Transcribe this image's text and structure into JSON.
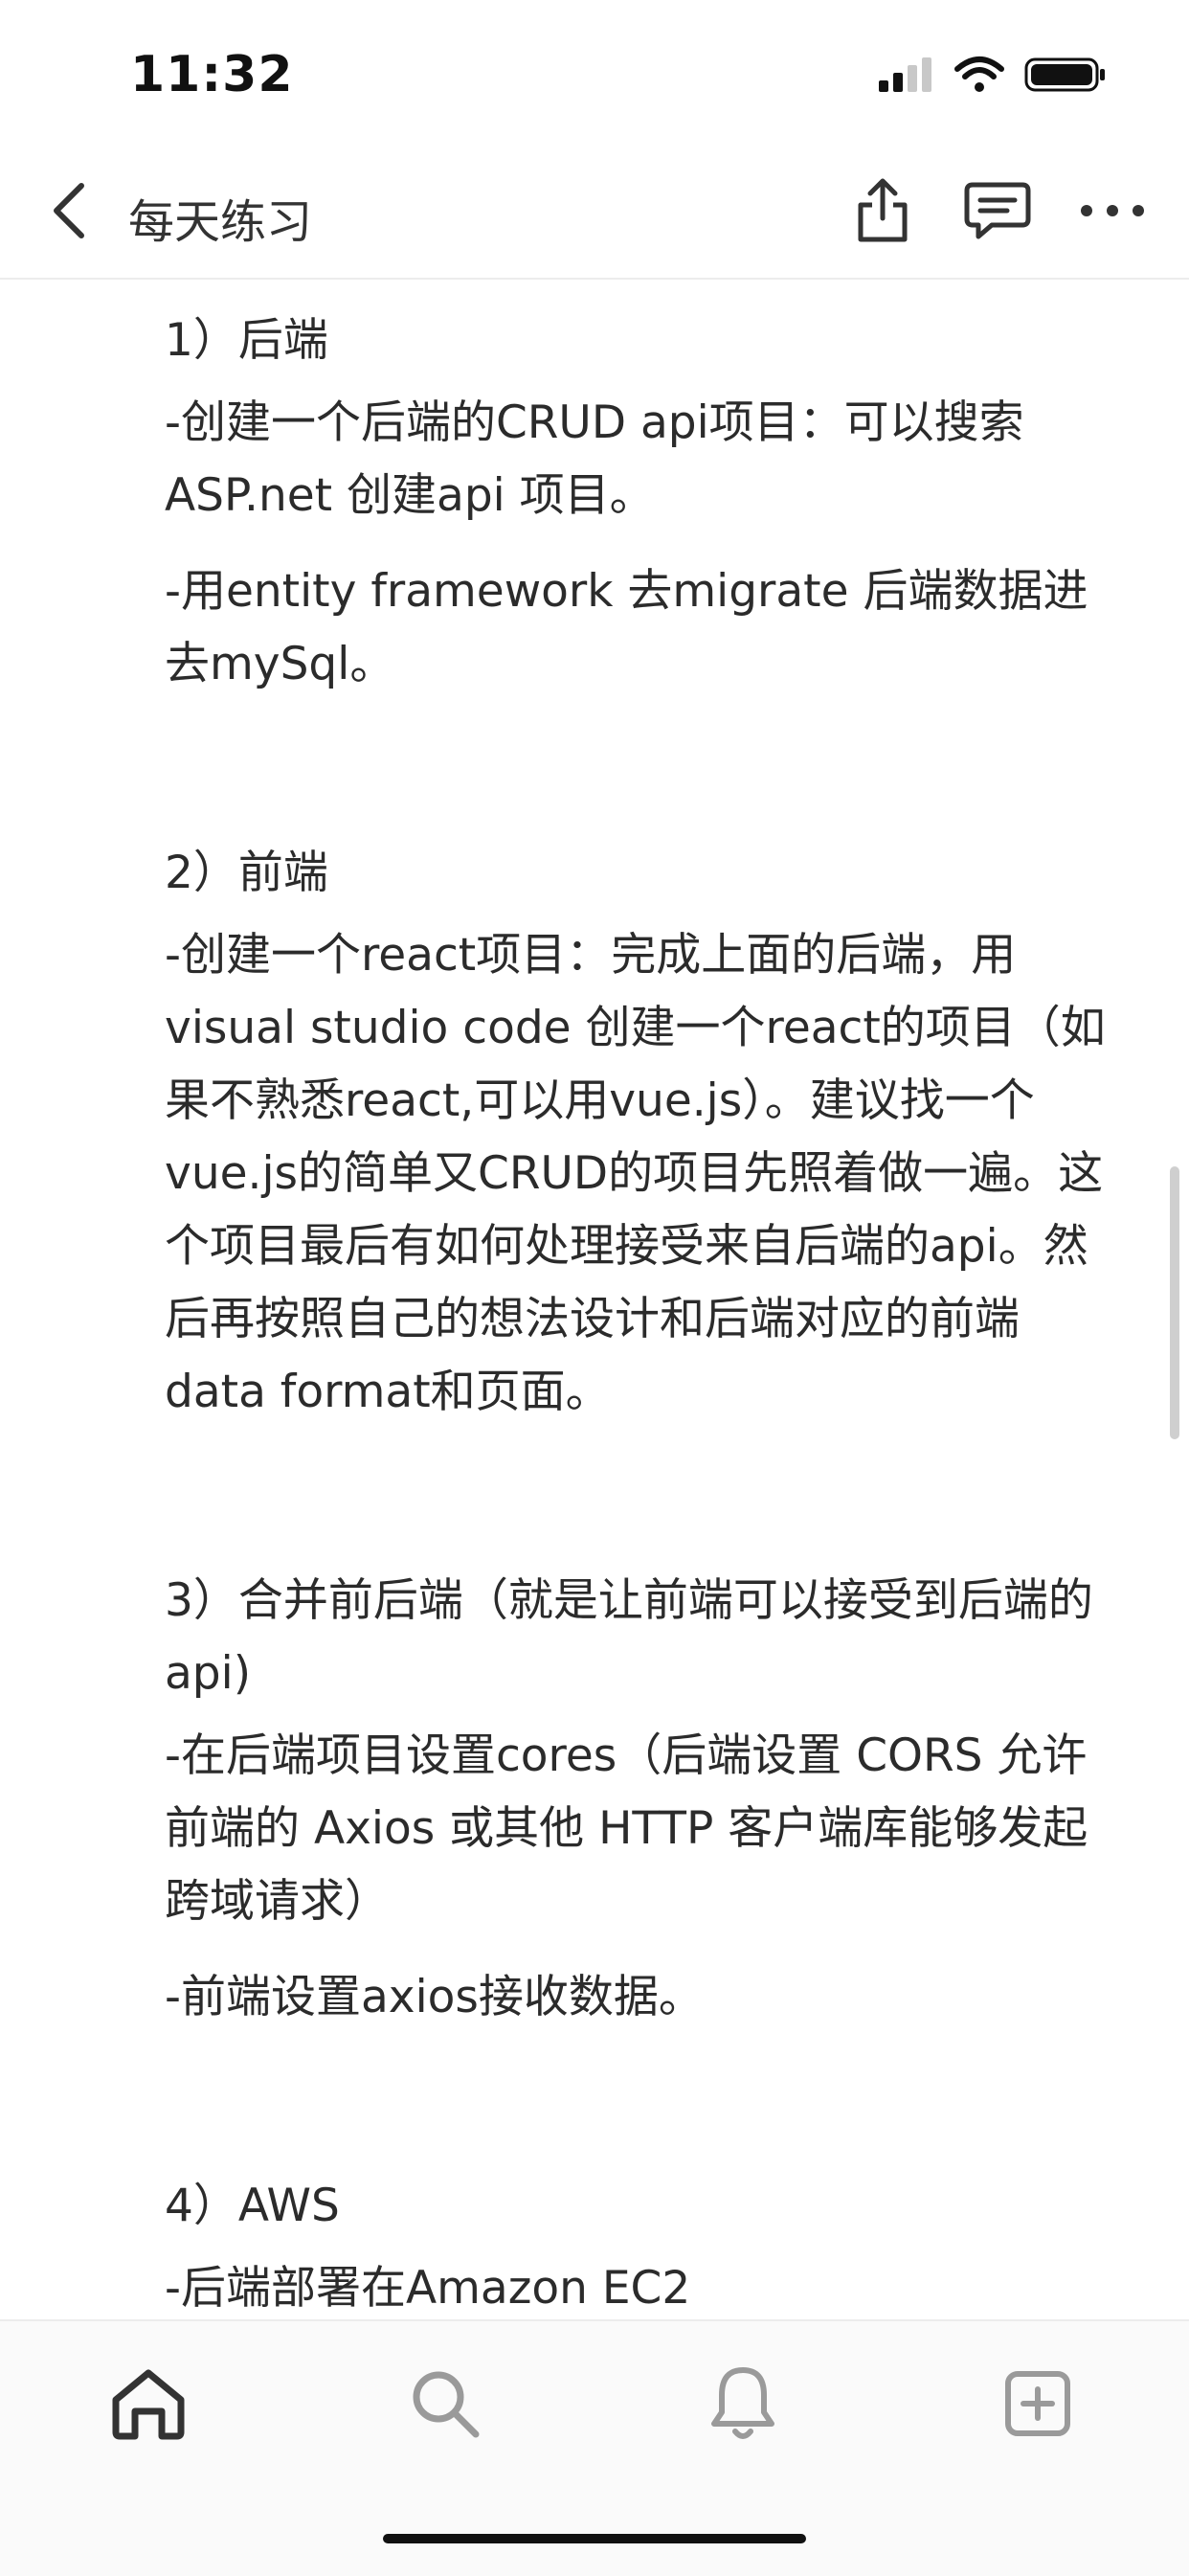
{
  "status": {
    "time": "11:32"
  },
  "nav": {
    "title": "每天练习"
  },
  "sections": [
    {
      "title": "1）后端",
      "paragraphs": [
        "-创建一个后端的CRUD api项目：可以搜索ASP.net 创建api 项目。",
        "-用entity framework 去migrate 后端数据进去mySql。"
      ]
    },
    {
      "title": "2）前端",
      "paragraphs": [
        "-创建一个react项目：完成上面的后端，用visual studio code 创建一个react的项目（如果不熟悉react,可以用vue.js）。建议找一个vue.js的简单又CRUD的项目先照着做一遍。这个项目最后有如何处理接受来自后端的api。然后再按照自己的想法设计和后端对应的前端data format和页面。"
      ]
    },
    {
      "title": "3）合并前后端（就是让前端可以接受到后端的api)",
      "paragraphs": [
        "-在后端项目设置cores（后端设置 CORS 允许前端的 Axios 或其他 HTTP 客户端库能够发起跨域请求）",
        "-前端设置axios接收数据。"
      ]
    },
    {
      "title": "4）AWS",
      "paragraphs": [
        "-后端部署在Amazon EC2"
      ]
    }
  ],
  "icons": {
    "back": "chevron-left-icon",
    "share": "share-icon",
    "comment": "comment-icon",
    "more": "more-icon",
    "home": "home-icon",
    "search": "search-icon",
    "notifications": "bell-icon",
    "add": "add-square-icon"
  },
  "colors": {
    "text": "#2b2b2b",
    "icon": "#333333",
    "tab_inactive": "#9a9a9a"
  }
}
